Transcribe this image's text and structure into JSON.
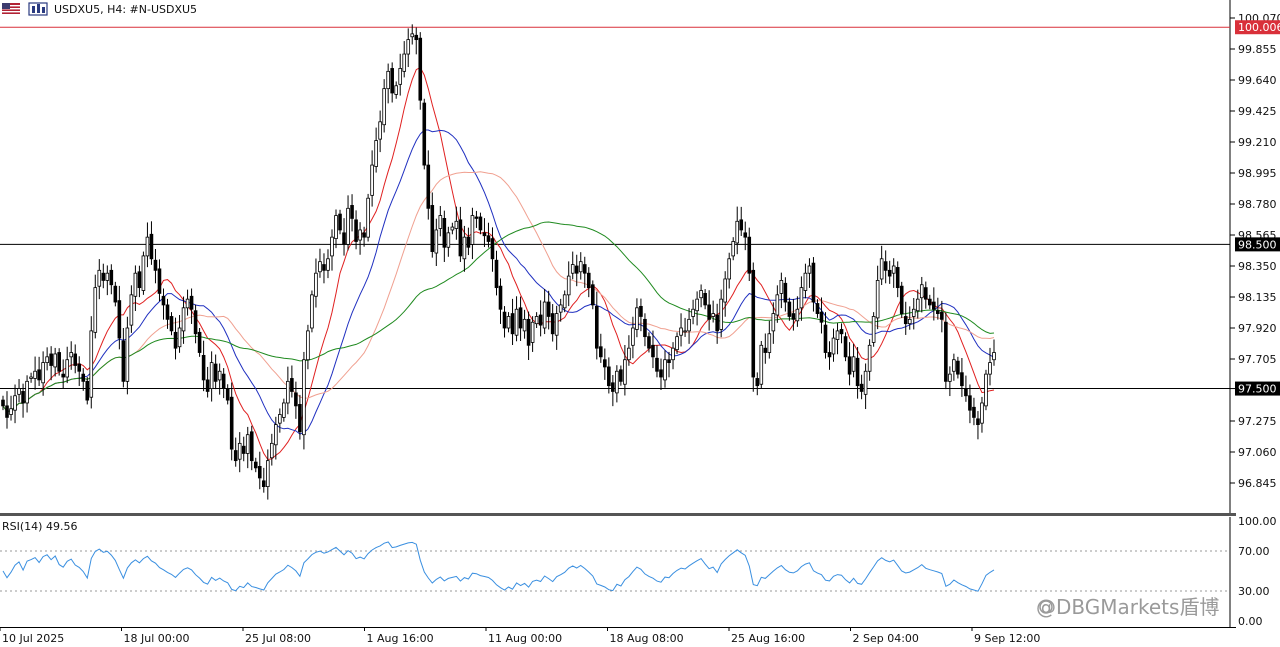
{
  "header": {
    "title": "USDXU5, H4:  #N-USDXU5",
    "toolbar_icons": [
      "flag-icon",
      "chart-type-icon"
    ]
  },
  "rsi": {
    "label": "RSI(14) 49.56",
    "ticks": [
      "100.00",
      "70.00",
      "30.00",
      "0.00"
    ],
    "levels": [
      70,
      30
    ]
  },
  "watermark": "@DBGMarkets盾博",
  "chart_data": {
    "type": "candlestick",
    "symbol": "USDXU5",
    "timeframe": "H4",
    "price_ticks": [
      "100.070",
      "99.855",
      "99.640",
      "99.425",
      "99.210",
      "98.995",
      "98.780",
      "98.565",
      "98.350",
      "98.135",
      "97.920",
      "97.705",
      "97.500",
      "97.275",
      "97.060",
      "96.845"
    ],
    "ylim": [
      96.7,
      100.13
    ],
    "time_ticks": [
      "10 Jul 2025",
      "18 Jul 00:00",
      "25 Jul 08:00",
      "1 Aug 16:00",
      "11 Aug 00:00",
      "18 Aug 08:00",
      "25 Aug 16:00",
      "2 Sep 04:00",
      "9 Sep 12:00"
    ],
    "horizontal_lines": [
      {
        "price": 100.006,
        "label": "100.006",
        "color": "#d9303a"
      },
      {
        "price": 98.5,
        "label": "98.500",
        "color": "#000000"
      },
      {
        "price": 97.5,
        "label": "97.500",
        "color": "#000000"
      }
    ],
    "close_series": [
      97.38,
      97.3,
      97.36,
      97.45,
      97.5,
      97.4,
      97.55,
      97.58,
      97.62,
      97.56,
      97.68,
      97.72,
      97.66,
      97.74,
      97.62,
      97.58,
      97.7,
      97.75,
      97.66,
      97.62,
      97.55,
      97.42,
      97.9,
      98.2,
      98.32,
      98.25,
      98.3,
      98.22,
      98.1,
      97.85,
      97.55,
      97.92,
      98.15,
      98.3,
      98.2,
      98.42,
      98.55,
      98.4,
      98.32,
      98.16,
      98.08,
      97.98,
      97.9,
      97.78,
      97.92,
      98.06,
      98.12,
      98.05,
      97.88,
      97.75,
      97.56,
      97.48,
      97.68,
      97.55,
      97.62,
      97.5,
      97.42,
      97.08,
      97.0,
      97.12,
      97.05,
      97.18,
      97.0,
      96.95,
      96.88,
      96.82,
      97.0,
      97.12,
      97.25,
      97.32,
      97.4,
      97.55,
      97.48,
      97.38,
      97.2,
      97.7,
      97.9,
      98.15,
      98.3,
      98.38,
      98.32,
      98.4,
      98.55,
      98.7,
      98.6,
      98.5,
      98.75,
      98.68,
      98.52,
      98.6,
      98.55,
      98.82,
      99.05,
      99.22,
      99.35,
      99.58,
      99.7,
      99.55,
      99.6,
      99.72,
      99.82,
      99.92,
      99.96,
      99.92,
      99.5,
      99.05,
      98.75,
      98.45,
      98.6,
      98.7,
      98.48,
      98.58,
      98.62,
      98.66,
      98.42,
      98.55,
      98.48,
      98.7,
      98.68,
      98.6,
      98.56,
      98.52,
      98.4,
      98.2,
      98.05,
      97.92,
      98.0,
      97.88,
      98.05,
      97.92,
      97.98,
      97.8,
      97.96,
      98.0,
      97.94,
      98.1,
      98.0,
      97.88,
      98.02,
      98.08,
      98.15,
      98.28,
      98.36,
      98.3,
      98.38,
      98.3,
      98.2,
      98.08,
      97.78,
      97.72,
      97.65,
      97.52,
      97.48,
      97.62,
      97.55,
      97.7,
      97.78,
      97.92,
      98.06,
      98.0,
      97.86,
      97.78,
      97.72,
      97.62,
      97.58,
      97.7,
      97.68,
      97.78,
      97.86,
      97.92,
      97.9,
      97.98,
      98.05,
      98.12,
      98.18,
      98.08,
      97.98,
      98.02,
      97.9,
      98.12,
      98.26,
      98.4,
      98.52,
      98.66,
      98.6,
      98.55,
      98.3,
      97.58,
      97.52,
      97.8,
      97.75,
      97.88,
      98.02,
      98.15,
      98.25,
      98.1,
      98.0,
      97.98,
      98.05,
      98.2,
      98.3,
      98.35,
      98.1,
      98.02,
      97.96,
      97.75,
      97.72,
      97.85,
      97.9,
      97.88,
      97.72,
      97.6,
      97.72,
      97.52,
      97.48,
      97.62,
      97.8,
      98.0,
      98.25,
      98.4,
      98.32,
      98.28,
      98.35,
      98.2,
      98.02,
      97.95,
      97.98,
      98.05,
      98.12,
      98.22,
      98.12,
      98.08,
      98.05,
      98.02,
      97.98,
      97.55,
      97.6,
      97.7,
      97.6,
      97.52,
      97.45,
      97.35,
      97.3,
      97.25,
      97.4,
      97.6,
      97.68,
      97.75
    ]
  }
}
